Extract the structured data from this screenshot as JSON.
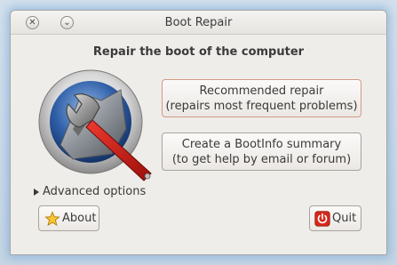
{
  "window": {
    "title": "Boot Repair"
  },
  "main": {
    "heading": "Repair the boot of the computer",
    "recommended": {
      "line1": "Recommended repair",
      "line2": "(repairs most frequent problems)"
    },
    "bootinfo": {
      "line1": "Create a BootInfo summary",
      "line2": "(to get help by email or forum)"
    },
    "advanced_label": "Advanced options"
  },
  "footer": {
    "about_label": "About",
    "quit_label": "Quit"
  },
  "icons": {
    "logo": "boot-repair-logo-icon",
    "about": "star-icon",
    "quit": "power-icon",
    "close": "close-icon",
    "minimize": "chevron-down-icon"
  },
  "colors": {
    "accent_border": "#d39a86",
    "window_bg": "#efedea"
  }
}
